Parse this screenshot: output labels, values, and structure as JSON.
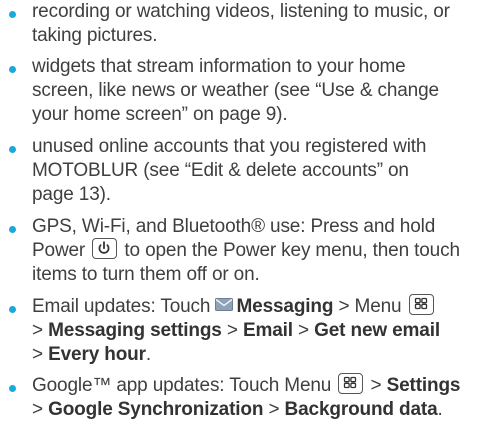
{
  "colors": {
    "bullet": "#1aa9dc",
    "text": "#3f3f3f"
  },
  "items": [
    {
      "l1": "recording or watching videos, listening to music, or",
      "l2": "taking pictures."
    },
    {
      "l1": "widgets that stream information to your home",
      "l2": "screen, like news or weather (see “Use & change",
      "l3": "your home screen” on page 9)."
    },
    {
      "l1": "unused online accounts that you registered with",
      "l2": "MOTOBLUR (see “Edit & delete accounts” on",
      "l3": "page 13)."
    },
    {
      "l1": "GPS, Wi-Fi, and Bluetooth® use: Press and hold",
      "l2a": "Power",
      "l2b": "to open the Power key menu, then touch",
      "l3": "items to turn them off or on."
    },
    {
      "l1a": "Email updates: Touch",
      "l1b": "Messaging",
      "l1c": "> Menu",
      "l2a": ">",
      "l2b": "Messaging settings",
      "l2c": ">",
      "l2d": "Email",
      "l2e": ">",
      "l2f": "Get new email",
      "l3a": ">",
      "l3b": "Every hour",
      "l3c": "."
    },
    {
      "l1a": "Google™ app updates: Touch Menu",
      "l1b": ">",
      "l1c": "Settings",
      "l2a": ">",
      "l2b": "Google Synchronization",
      "l2c": ">",
      "l2d": "Background data",
      "l2e": "."
    }
  ],
  "icons": {
    "power": "power-key-icon",
    "menu": "menu-key-icon",
    "messaging": "envelope-icon"
  }
}
